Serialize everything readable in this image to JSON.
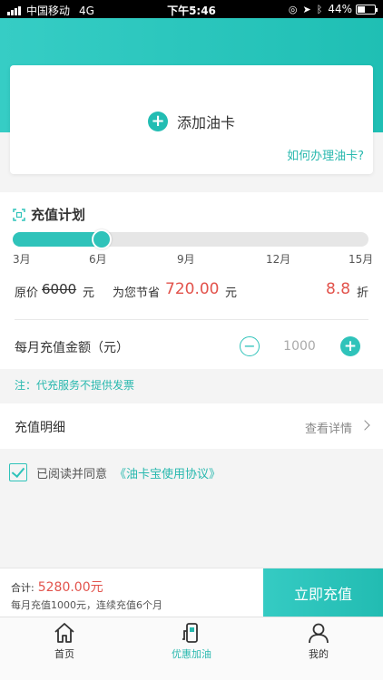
{
  "status_bar": {
    "carrier": "中国移动",
    "network": "4G",
    "time": "下午5:46",
    "battery": "44%",
    "battery_level": 0.44
  },
  "card": {
    "add_label": "添加油卡",
    "how_link": "如何办理油卡?"
  },
  "plan": {
    "title": "充值计划",
    "slider_value": 0.25,
    "ticks": [
      "3月",
      "6月",
      "9月",
      "12月",
      "15月"
    ],
    "original_label": "原价",
    "original_value": "6000",
    "original_unit": "元",
    "saving_label": "为您节省",
    "saving_value": "720.00",
    "saving_unit": "元",
    "discount_value": "8.8",
    "discount_unit": "折",
    "amount_label": "每月充值金额（元）",
    "amount_value": "1000"
  },
  "note": "注：代充服务不提供发票",
  "detail": {
    "label": "充值明细",
    "link": "查看详情"
  },
  "agreement": {
    "text": "已阅读并同意",
    "link": "《油卡宝使用协议》"
  },
  "bottom": {
    "total_label": "合计:",
    "total_value": "5280.00元",
    "sub": "每月充值1000元，连续充值6个月",
    "cta": "立即充值"
  },
  "tabs": [
    {
      "label": "首页",
      "icon": "home-icon"
    },
    {
      "label": "优惠加油",
      "icon": "fuel-pump-icon"
    },
    {
      "label": "我的",
      "icon": "user-icon"
    }
  ],
  "colors": {
    "accent": "#2fc3ba",
    "price": "#e2534c"
  }
}
